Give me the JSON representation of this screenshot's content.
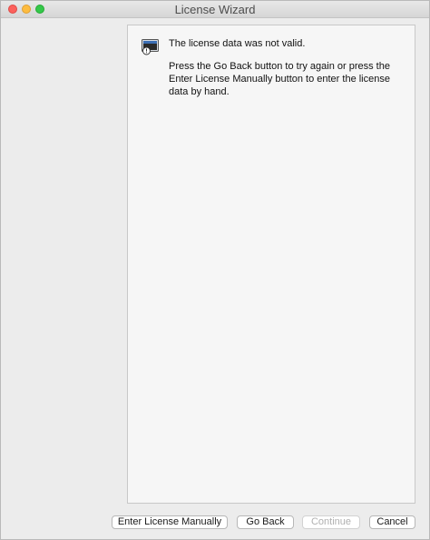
{
  "window": {
    "title": "License Wizard",
    "close_color": "#fc605c",
    "minimize_color": "#fdbc40",
    "maximize_color": "#34c84a"
  },
  "message": {
    "icon": "monitor-alert-icon",
    "title": "The license data was not valid.",
    "body": "Press the Go Back button to try again or press the Enter License Manually button to enter the license data by hand."
  },
  "buttons": {
    "enter_manually": "Enter License Manually",
    "go_back": "Go Back",
    "continue": "Continue",
    "cancel": "Cancel"
  }
}
